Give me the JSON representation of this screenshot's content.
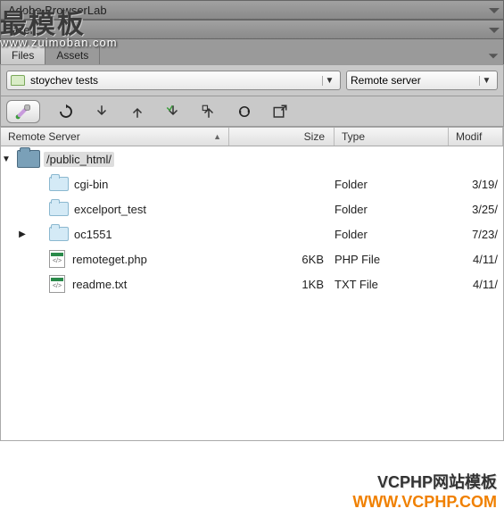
{
  "watermark": {
    "top_big": "最模板",
    "top_small": "www.zuimoban.com",
    "bottom1": "VCPHP网站模板",
    "bottom2": "WWW.VCPHP.COM"
  },
  "panel1": {
    "title": "Adobe BrowserLab"
  },
  "panel2": {
    "title": "Insert"
  },
  "tabs": {
    "files": "Files",
    "assets": "Assets"
  },
  "site_dropdown": {
    "label": "stoychev tests"
  },
  "server_dropdown": {
    "label": "Remote server"
  },
  "columns": {
    "name": "Remote Server",
    "size": "Size",
    "type": "Type",
    "modified": "Modif"
  },
  "root": {
    "path": "/public_html/"
  },
  "rows": [
    {
      "name": "cgi-bin",
      "size": "",
      "type": "Folder",
      "modified": "3/19/",
      "kind": "folder",
      "expandable": false
    },
    {
      "name": "excelport_test",
      "size": "",
      "type": "Folder",
      "modified": "3/25/",
      "kind": "folder",
      "expandable": false
    },
    {
      "name": "oc1551",
      "size": "",
      "type": "Folder",
      "modified": "7/23/",
      "kind": "folder",
      "expandable": true
    },
    {
      "name": "remoteget.php",
      "size": "6KB",
      "type": "PHP File",
      "modified": "4/11/",
      "kind": "file",
      "expandable": false
    },
    {
      "name": "readme.txt",
      "size": "1KB",
      "type": "TXT File",
      "modified": "4/11/",
      "kind": "file",
      "expandable": false
    }
  ]
}
